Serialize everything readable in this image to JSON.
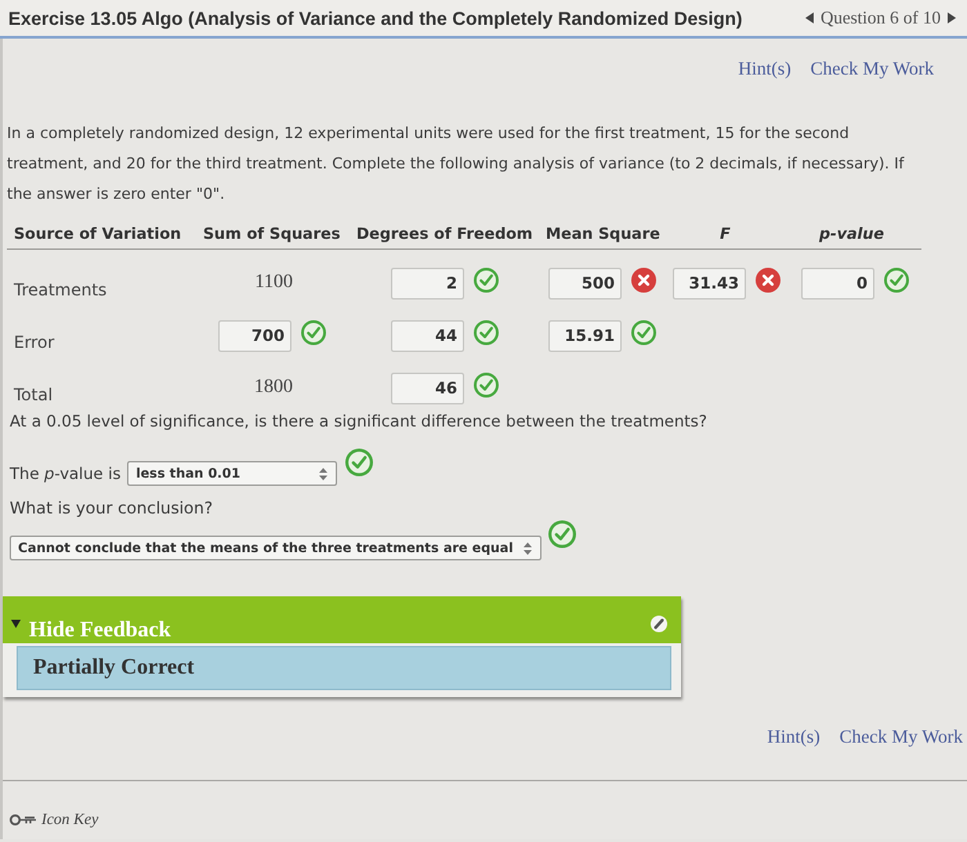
{
  "header": {
    "title": "Exercise 13.05 Algo (Analysis of Variance and the Completely Randomized Design)",
    "question_nav": "Question 6 of 10"
  },
  "top_links": [
    "Hint(s)",
    "Check My Work"
  ],
  "prompt": "In a completely randomized design, 12 experimental units were used for the first treatment, 15 for the second treatment, and 20 for the third treatment. Complete the following analysis of variance (to 2 decimals, if necessary). If the answer is zero enter \"0\".",
  "anova_table": {
    "columns": [
      {
        "label": "Source of Variation",
        "italic": false
      },
      {
        "label": "Sum of Squares",
        "italic": false
      },
      {
        "label": "Degrees of Freedom",
        "italic": false
      },
      {
        "label": "Mean Square",
        "italic": false
      },
      {
        "label": "F",
        "italic": true
      },
      {
        "label": "p-value",
        "italic": true
      }
    ],
    "rows": [
      {
        "cells": [
          {
            "kind": "label",
            "value": "Treatments"
          },
          {
            "kind": "given",
            "value": "1100"
          },
          {
            "kind": "input",
            "value": "2",
            "correct": true
          },
          {
            "kind": "input",
            "value": "500",
            "correct": false
          },
          {
            "kind": "input",
            "value": "31.43",
            "correct": false
          },
          {
            "kind": "input",
            "value": "0",
            "correct": true
          }
        ]
      },
      {
        "cells": [
          {
            "kind": "label",
            "value": "Error"
          },
          {
            "kind": "input",
            "value": "700",
            "correct": true
          },
          {
            "kind": "input",
            "value": "44",
            "correct": true
          },
          {
            "kind": "input",
            "value": "15.91",
            "correct": true
          }
        ]
      },
      {
        "cells": [
          {
            "kind": "label",
            "value": "Total"
          },
          {
            "kind": "given",
            "value": "1800"
          },
          {
            "kind": "input",
            "value": "46",
            "correct": true
          }
        ]
      }
    ]
  },
  "significance_question": "At a 0.05 level of significance, is there a significant difference between the treatments?",
  "p_value_answer": {
    "label": "The *p*-value is",
    "value": "less than 0.01",
    "correct": true
  },
  "conclusion": {
    "question": "What is your conclusion?",
    "value": "Cannot conclude that the means of the three treatments are equal",
    "correct": true
  },
  "feedback": {
    "toggle_label": "Hide Feedback",
    "expanded": true,
    "result": "Partially Correct"
  },
  "bottom_links": [
    "Hint(s)",
    "Check My Work"
  ],
  "footer": {
    "icon_key": "Icon Key"
  }
}
